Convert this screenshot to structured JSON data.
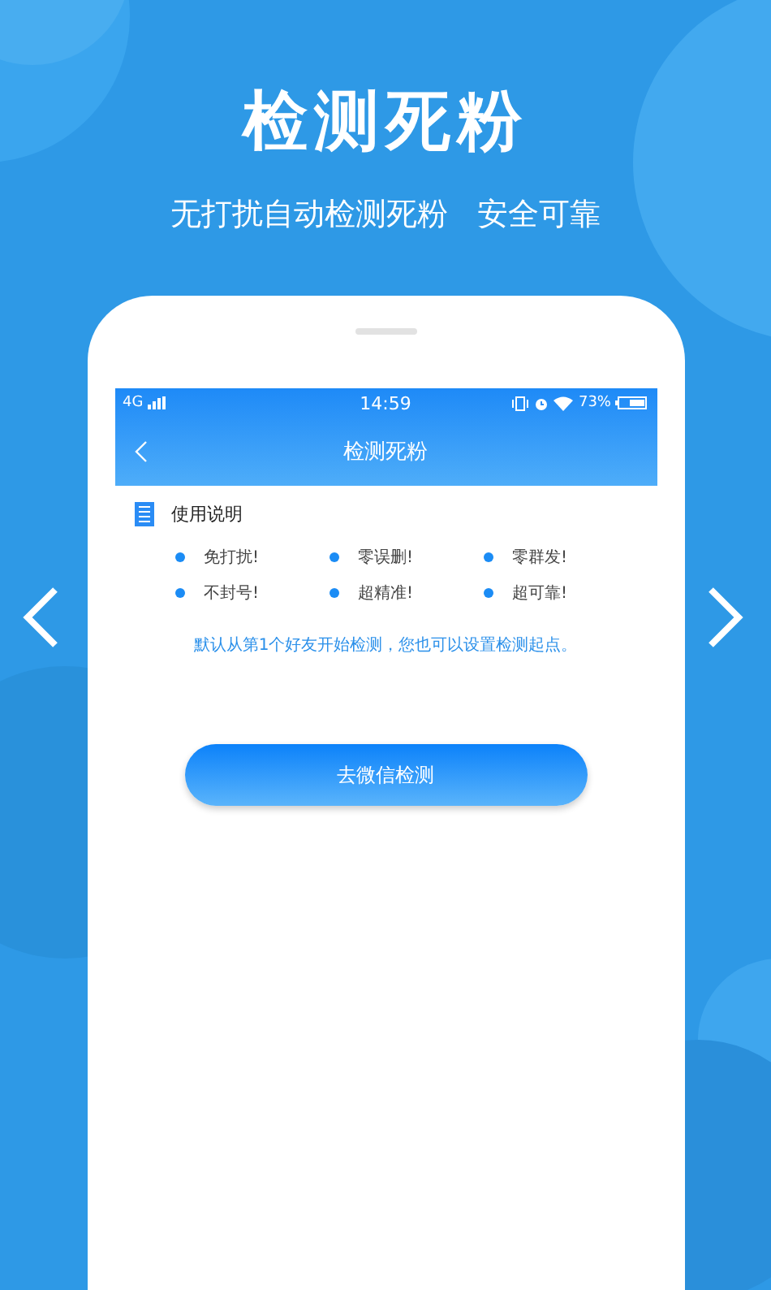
{
  "headline": "检测死粉",
  "tagline": "无打扰自动检测死粉   安全可靠",
  "phone": {
    "status_bar": {
      "network": "4G",
      "time": "14:59",
      "battery": "73%"
    },
    "nav": {
      "title": "检测死粉"
    },
    "instructions": {
      "title": "使用说明",
      "features": [
        "免打扰!",
        "零误删!",
        "零群发!",
        "不封号!",
        "超精准!",
        "超可靠!"
      ],
      "note": "默认从第1个好友开始检测，您也可以设置检测起点。"
    },
    "action_button": "去微信检测"
  }
}
